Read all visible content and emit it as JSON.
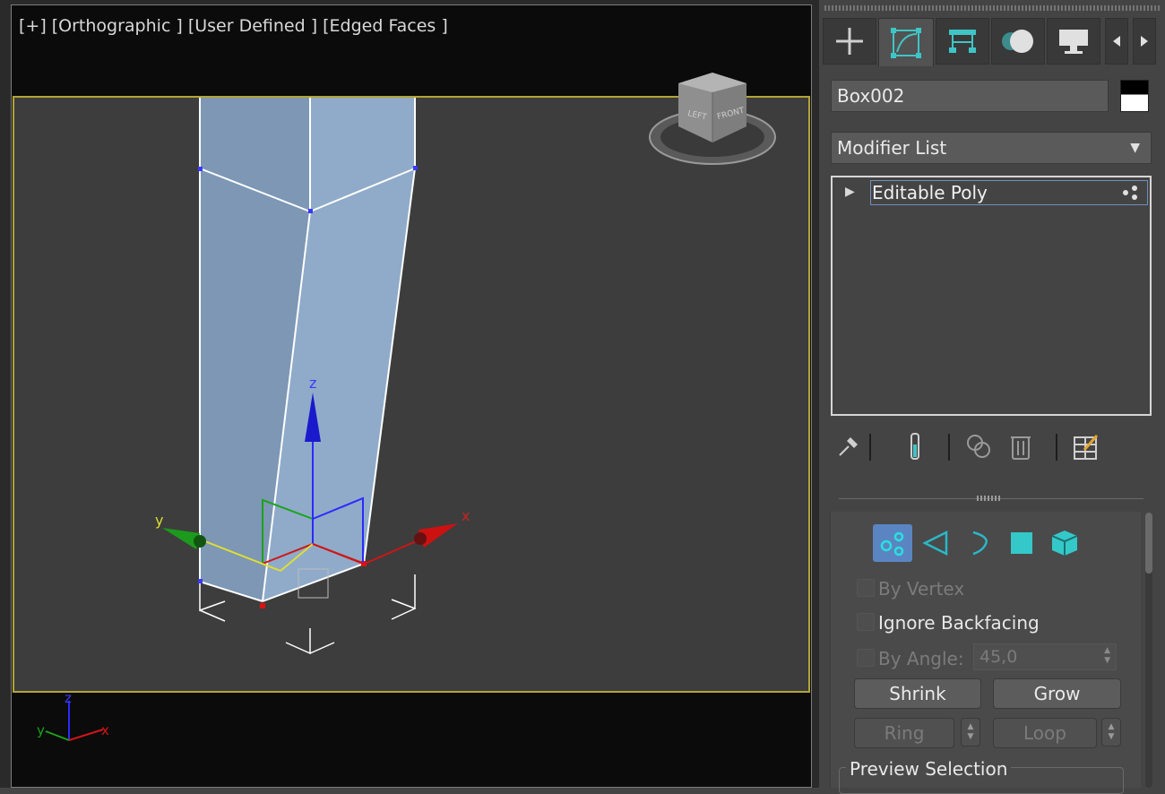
{
  "viewport": {
    "labels": [
      "[+]",
      "[Orthographic ]",
      "[User Defined ]",
      "[Edged Faces ]"
    ],
    "gizmo": {
      "z_label": "z",
      "y_label": "y",
      "x_label": "x"
    },
    "tripod": {
      "z_label": "z",
      "y_label": "y",
      "x_label": "x"
    },
    "viewcube": {
      "face_left": "LEFT",
      "face_front": "FRONT"
    },
    "colors": {
      "frame": "#b3a436",
      "object": "#8aa5c4",
      "x_axis": "#cc1111",
      "y_axis": "#1d9a1d",
      "z_axis": "#1a1acc"
    }
  },
  "command_panel": {
    "tabs": [
      {
        "name": "create",
        "icon": "plus-icon"
      },
      {
        "name": "modify",
        "icon": "modify-icon",
        "active": true
      },
      {
        "name": "hierarchy",
        "icon": "hierarchy-icon"
      },
      {
        "name": "motion",
        "icon": "motion-icon"
      },
      {
        "name": "display",
        "icon": "display-icon"
      }
    ],
    "object_name": "Box002",
    "modifier_list": "Modifier List",
    "stack": [
      {
        "label": "Editable Poly"
      }
    ],
    "accent": "#5a85c2"
  },
  "selection": {
    "by_vertex": "By Vertex",
    "ignore_backfacing": "Ignore Backfacing",
    "by_angle": "By Angle:",
    "angle_value": "45,0",
    "shrink": "Shrink",
    "grow": "Grow",
    "ring": "Ring",
    "loop": "Loop",
    "preview_selection": "Preview Selection"
  }
}
